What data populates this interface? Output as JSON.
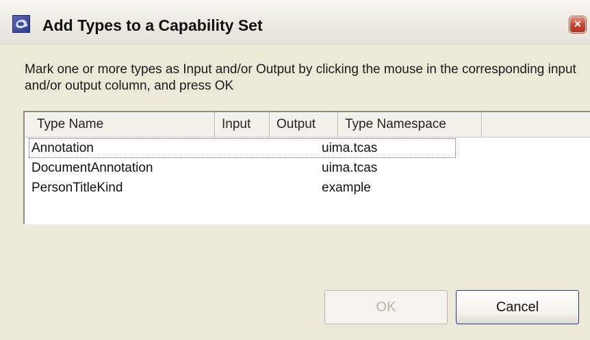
{
  "window": {
    "title": "Add Types to a Capability Set",
    "app_icon": "eclipse-app-icon",
    "close_icon": "close-x-icon",
    "close_glyph": "×"
  },
  "instructions": "Mark one or more types as Input and/or Output by clicking the mouse in the corresponding input and/or output column, and press OK",
  "table": {
    "columns": [
      "Type Name",
      "Input",
      "Output",
      "Type Namespace"
    ],
    "rows": [
      {
        "type_name": "Annotation",
        "input": "",
        "output": "",
        "namespace": "uima.tcas"
      },
      {
        "type_name": "DocumentAnnotation",
        "input": "",
        "output": "",
        "namespace": "uima.tcas"
      },
      {
        "type_name": "PersonTitleKind",
        "input": "",
        "output": "",
        "namespace": "example"
      }
    ]
  },
  "buttons": {
    "ok_label": "OK",
    "ok_enabled": false,
    "cancel_label": "Cancel"
  },
  "colors": {
    "dialog_background": "#ece9d8",
    "close_button": "#c8432e",
    "disabled_text": "#b5b2a6",
    "default_button_border": "#1f3b8a"
  }
}
